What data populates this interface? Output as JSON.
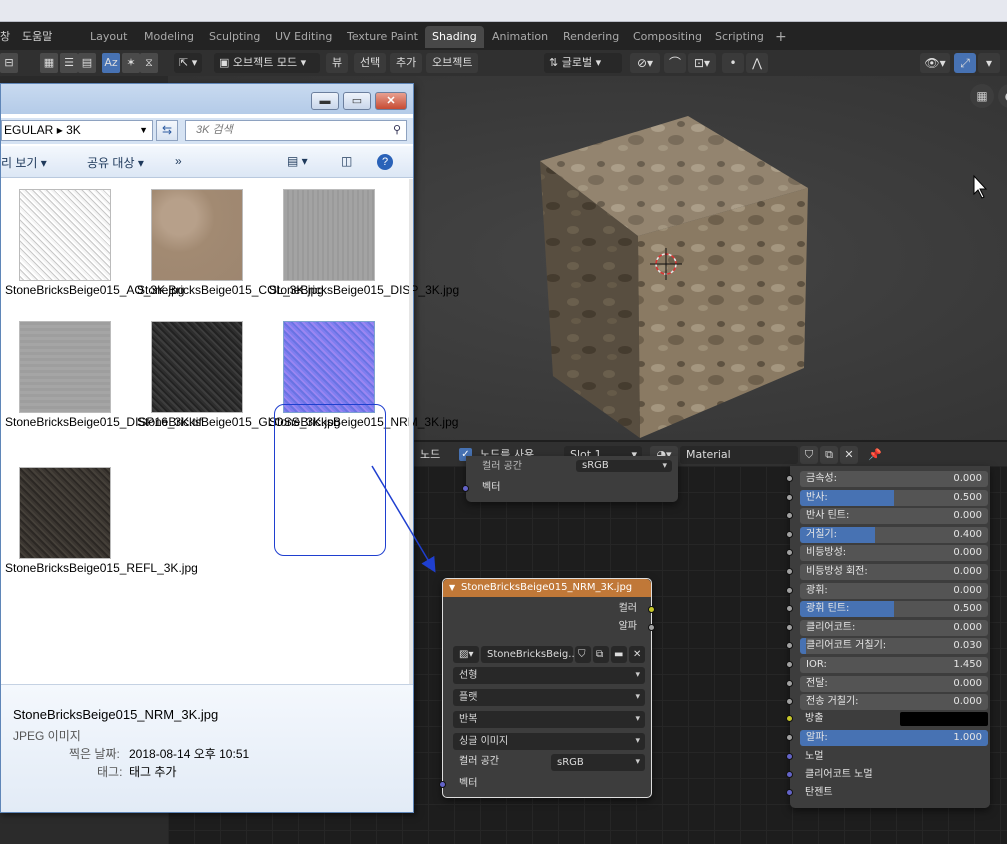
{
  "menubar": {
    "menus": [
      "창",
      "도움말"
    ],
    "workspaces": [
      "Layout",
      "Modeling",
      "Sculpting",
      "UV Editing",
      "Texture Paint",
      "Shading",
      "Animation",
      "Rendering",
      "Compositing",
      "Scripting"
    ],
    "active_workspace": "Shading"
  },
  "header3d": {
    "mode": "오브젝트 모드",
    "view": "뷰",
    "select": "선택",
    "add": "추가",
    "object": "오브젝트",
    "transform_orientation": "글로벌"
  },
  "explorer": {
    "path_part1": "EGULAR",
    "path_part2": "3K",
    "search_placeholder": "3K 검색",
    "toolbar": {
      "view": "리 보기",
      "share": "공유 대상",
      "more": "»"
    },
    "files": [
      {
        "name": "StoneBricksBeige015_AO_3K.jpg"
      },
      {
        "name": "StoneBricksBeige015_COL_3K.jpg"
      },
      {
        "name": "StoneBricksBeige015_DISP_3K.jpg"
      },
      {
        "name": "StoneBricksBeige015_DISP16_3K.tif"
      },
      {
        "name": "StoneBricksBeige015_GLOSS_3K.jpg"
      },
      {
        "name": "StoneBricksBeige015_NRM_3K.jpg"
      },
      {
        "name": "StoneBricksBeige015_REFL_3K.jpg"
      }
    ],
    "details": {
      "filename": "StoneBricksBeige015_NRM_3K.jpg",
      "type": "JPEG 이미지",
      "date_label": "찍은 날짜:",
      "date_value": "2018-08-14 오후 10:51",
      "tag_label": "태그:",
      "tag_value": "태그 추가"
    }
  },
  "node_header": {
    "menu": "노드",
    "use_nodes": "노드를 사용",
    "slot": "Slot 1",
    "material": "Material"
  },
  "upper_node": {
    "color_space_partial": "컬러 공간",
    "color_space_value": "sRGB",
    "vector": "벡터"
  },
  "image_node": {
    "title": "StoneBricksBeige015_NRM_3K.jpg",
    "out_color": "컬러",
    "out_alpha": "알파",
    "image_name": "StoneBricksBeig...",
    "interpolation": "선형",
    "projection": "플랫",
    "extension": "반복",
    "source": "싱글 이미지",
    "color_space_label": "컬러 공간",
    "color_space": "sRGB",
    "vector": "벡터"
  },
  "bsdf": {
    "props": [
      {
        "label": "금속성:",
        "value": "0.000",
        "fill": 0
      },
      {
        "label": "반사:",
        "value": "0.500",
        "fill": 0.5
      },
      {
        "label": "반사 틴트:",
        "value": "0.000",
        "fill": 0
      },
      {
        "label": "거칠기:",
        "value": "0.400",
        "fill": 0.4
      },
      {
        "label": "비등방성:",
        "value": "0.000",
        "fill": 0
      },
      {
        "label": "비등방성 회전:",
        "value": "0.000",
        "fill": 0
      },
      {
        "label": "광휘:",
        "value": "0.000",
        "fill": 0
      },
      {
        "label": "광휘 틴트:",
        "value": "0.500",
        "fill": 0.5
      },
      {
        "label": "클리어코트:",
        "value": "0.000",
        "fill": 0
      },
      {
        "label": "클리어코트 거칠기:",
        "value": "0.030",
        "fill": 0.03
      },
      {
        "label": "IOR:",
        "value": "1.450",
        "fill": 0
      },
      {
        "label": "전달:",
        "value": "0.000",
        "fill": 0
      },
      {
        "label": "전송 거칠기:",
        "value": "0.000",
        "fill": 0
      }
    ],
    "emission": "방출",
    "alpha_label": "알파:",
    "alpha_value": "1.000",
    "normal": "노멀",
    "clearcoat_normal": "클리어코트 노멀",
    "tangent": "탄젠트"
  },
  "colors": {
    "accent": "#4772b3",
    "node_header_image": "#c07838",
    "selection_ring": "#1f3fcf"
  }
}
